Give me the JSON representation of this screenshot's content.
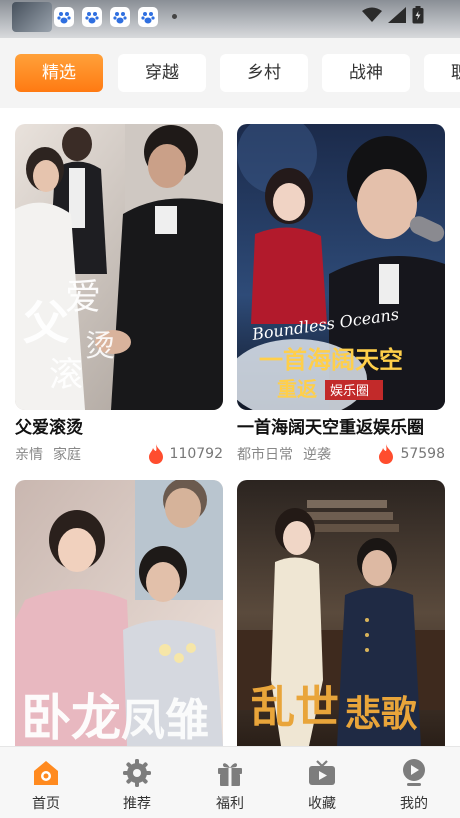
{
  "status_bar": {
    "icons": [
      "app-thumbnail",
      "baidu-app-icon",
      "baidu-app-icon",
      "baidu-app-icon",
      "notification-dot",
      "wifi-icon",
      "signal-icon",
      "battery-icon"
    ]
  },
  "tabs": [
    {
      "label": "精选",
      "active": true
    },
    {
      "label": "穿越",
      "active": false
    },
    {
      "label": "乡村",
      "active": false
    },
    {
      "label": "战神",
      "active": false
    },
    {
      "label": "职场",
      "active": false
    }
  ],
  "dramas": [
    {
      "title": "父爱滚烫",
      "tags": [
        "亲情",
        "家庭"
      ],
      "views": "110792",
      "poster_text": "父爱滚烫"
    },
    {
      "title": "一首海阔天空重返娱乐圈",
      "tags": [
        "都市日常",
        "逆袭"
      ],
      "views": "57598",
      "poster_text": "一首海阔天空重返娱乐圈",
      "poster_subtext": "Boundless Oceans"
    },
    {
      "title": "",
      "tags": [],
      "views": "",
      "poster_text": "卧龙凤雏"
    },
    {
      "title": "",
      "tags": [],
      "views": "",
      "poster_text": "乱世悲歌"
    }
  ],
  "bottom_nav": [
    {
      "label": "首页",
      "icon": "home-icon",
      "active": true
    },
    {
      "label": "推荐",
      "icon": "gear-icon",
      "active": false
    },
    {
      "label": "福利",
      "icon": "gift-icon",
      "active": false
    },
    {
      "label": "收藏",
      "icon": "tv-icon",
      "active": false
    },
    {
      "label": "我的",
      "icon": "profile-icon",
      "active": false
    }
  ],
  "colors": {
    "accent": "#ff8a1f",
    "fire": "#ff4d2e"
  }
}
